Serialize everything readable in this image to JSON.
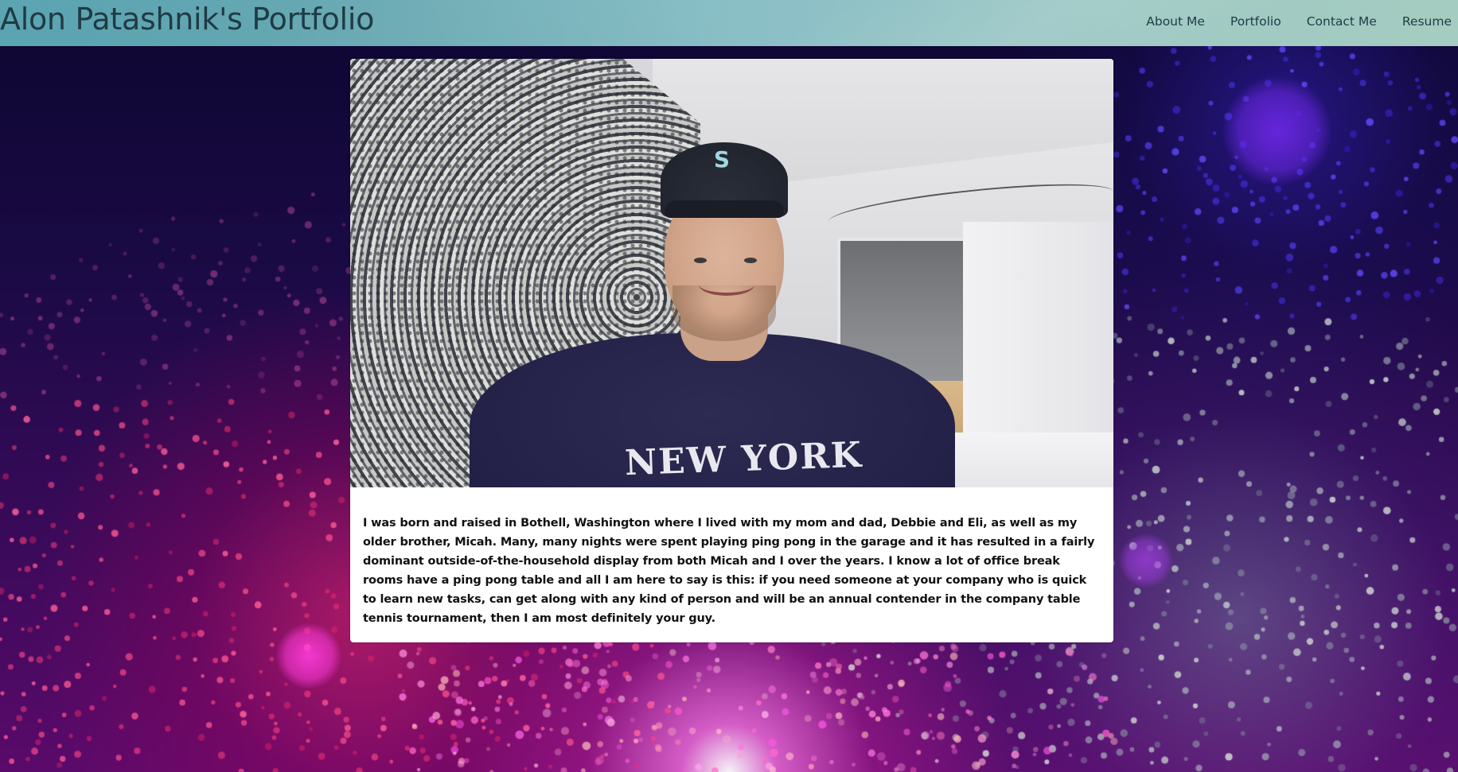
{
  "site": {
    "brand": "Alon Patashnik's Portfolio"
  },
  "nav": {
    "items": [
      {
        "label": "About Me"
      },
      {
        "label": "Portfolio"
      },
      {
        "label": "Contact Me"
      },
      {
        "label": "Resume"
      }
    ]
  },
  "about": {
    "photo_shirt_text": "NEW YORK",
    "photo_cap_logo": "S",
    "bio": "I was born and raised in Bothell, Washington where I lived with my mom and dad, Debbie and Eli, as well as my older brother, Micah. Many, many nights were spent playing ping pong in the garage and it has resulted in a fairly dominant outside-of-the-household display from both Micah and I over the years. I know a lot of office break rooms have a ping pong table and all I am here to say is this: if you need someone at your company who is quick to learn new tasks, can get along with any kind of person and will be an annual contender in the company table tennis tournament, then I am most definitely your guy."
  },
  "colors": {
    "navbar_left": "#4ea4b4",
    "navbar_right": "#a5ccc0",
    "nav_text": "#1f3b45",
    "background_dark": "#0d0630",
    "background_glow": "#ff50d0",
    "card_bg": "#ffffff"
  }
}
